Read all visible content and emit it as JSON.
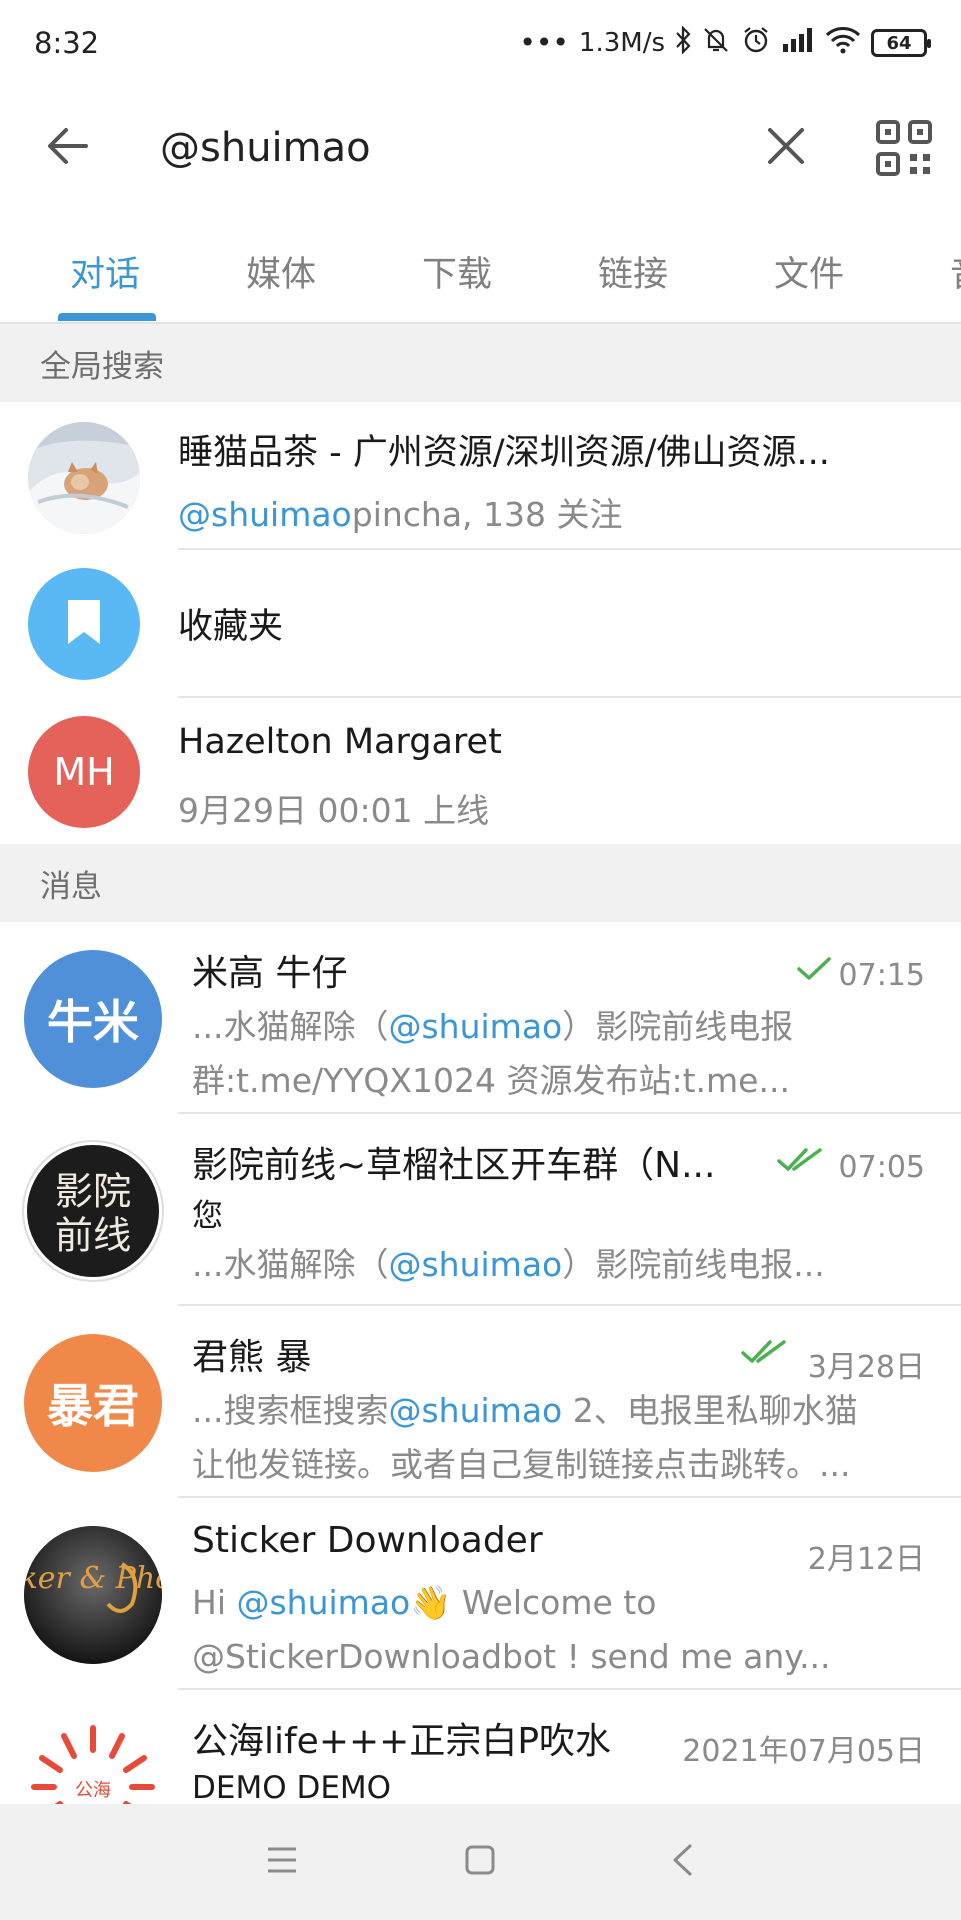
{
  "status_bar": {
    "time": "8:32",
    "network_speed": "1.3M/s",
    "battery": "64"
  },
  "search": {
    "query": "@shuimao"
  },
  "tabs": [
    {
      "label": "对话"
    },
    {
      "label": "媒体"
    },
    {
      "label": "下载"
    },
    {
      "label": "链接"
    },
    {
      "label": "文件"
    },
    {
      "label": "音"
    }
  ],
  "global_section": {
    "header": "全局搜索",
    "results": [
      {
        "title": "睡猫品茶 - 广州资源/深圳资源/佛山资源...",
        "sub_mention": "@shuimao",
        "sub_rest": "pincha, 138 关注"
      },
      {
        "title": "收藏夹"
      },
      {
        "avatar_initials": "MH",
        "avatar_color": "#e4625a",
        "title": "Hazelton Margaret",
        "sub": "9月29日 00:01 上线"
      }
    ]
  },
  "messages_section": {
    "header": "消息",
    "items": [
      {
        "avatar_text": "牛米",
        "avatar_color": "#4f90d8",
        "title": "米高 牛仔",
        "time": "07:15",
        "line1_pre": "...水猫解除（",
        "line1_mention": "@shuimao",
        "line1_post": "）影院前线电报",
        "line2": "群:t.me/YYQX1024 资源发布站:t.me..."
      },
      {
        "avatar_text": "影院前线",
        "title": "影院前线~草榴社区开车群（N...",
        "time": "07:05",
        "sender": "您",
        "line1_pre": "...水猫解除（",
        "line1_mention": "@shuimao",
        "line1_post": "）影院前线电报..."
      },
      {
        "avatar_text": "暴君",
        "avatar_color": "#f0884a",
        "title": "君熊 暴",
        "time": "3月28日",
        "line1_pre": "...搜索框搜索",
        "line1_mention": "@shuimao",
        "line1_post": " 2、电报里私聊水猫",
        "line2": "让他发链接。或者自己复制链接点击跳转。..."
      },
      {
        "avatar_text": "Sticker & Photo",
        "title": "Sticker Downloader",
        "time": "2月12日",
        "line1_pre": "Hi ",
        "line1_mention": "@shuimao",
        "line1_emoji": "👋",
        "line1_post": " Welcome to",
        "line2": "@StickerDownloadbot ! send me any..."
      },
      {
        "avatar_text": "公海",
        "title": "公海life+++正宗白P吹水",
        "time": "2021年07月05日",
        "sender": "DEMO DEMO"
      }
    ]
  },
  "icons": {
    "back": "arrow-left-icon",
    "clear": "close-icon",
    "qr": "qr-code-icon",
    "bookmark": "bookmark-icon",
    "check_single": "check-icon",
    "check_double": "double-check-icon",
    "nav_menu": "menu-icon",
    "nav_home": "home-icon",
    "nav_back": "back-chevron-icon"
  },
  "colors": {
    "accent": "#3a96d6",
    "check": "#4caf50",
    "bookmark_avatar": "#5ab8f5"
  }
}
